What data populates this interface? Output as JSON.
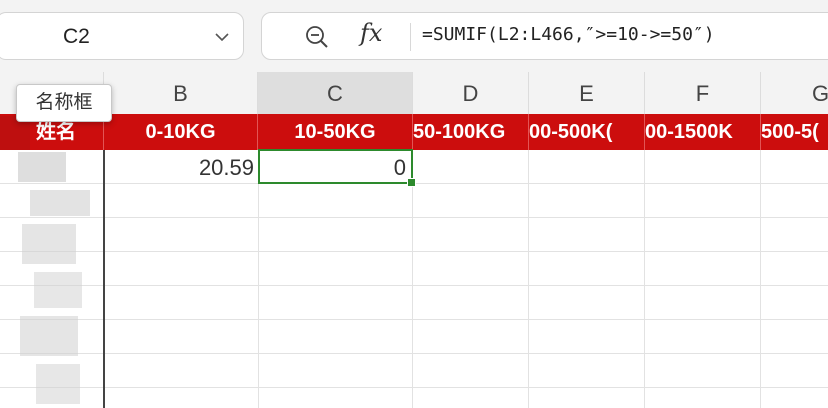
{
  "name_box": {
    "value": "C2"
  },
  "formula_bar": {
    "fx_label": "fx",
    "formula": "=SUMIF(L2:L466,″>=10->=50″)"
  },
  "tooltip": "名称框",
  "columns": [
    "B",
    "C",
    "D",
    "E",
    "F",
    "G"
  ],
  "active_column": "C",
  "header_row": {
    "a_partial": "姓名",
    "cells": [
      "0-10KG",
      "10-50KG",
      "50-100KG",
      "00-500K(",
      "00-1500K",
      "500-5("
    ]
  },
  "data_row": {
    "b": "20.59",
    "c": "0"
  },
  "colors": {
    "header_red": "#cc0d0d",
    "selection_green": "#2d8a2d"
  }
}
